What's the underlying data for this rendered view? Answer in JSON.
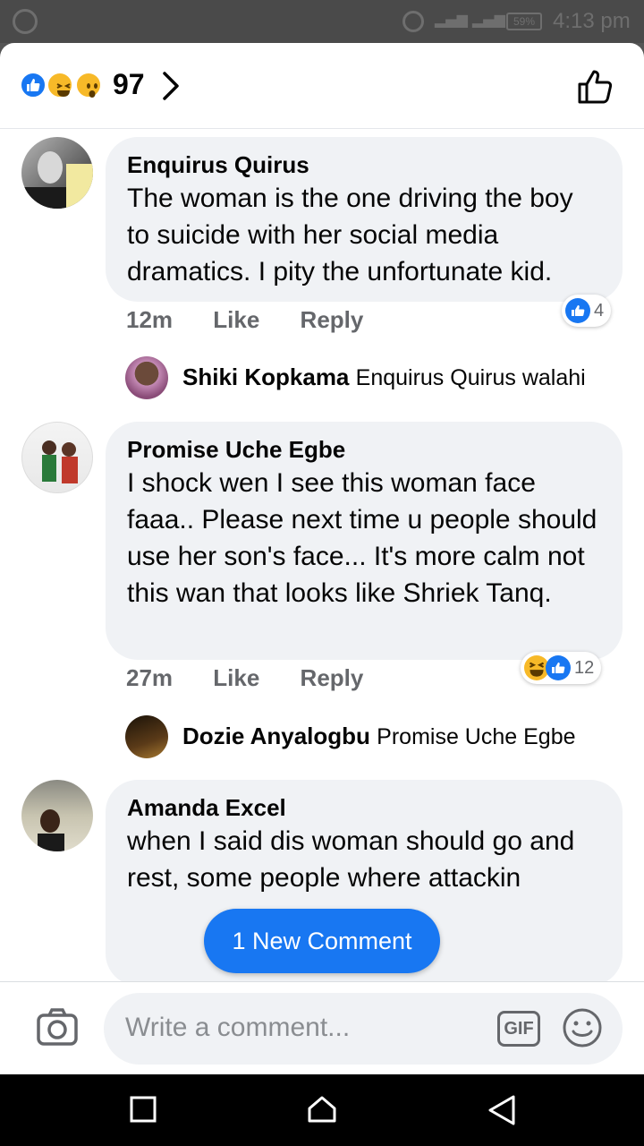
{
  "status_bar": {
    "time": "4:13 pm",
    "battery": "59%"
  },
  "reactions": {
    "count": "97",
    "types": [
      "like",
      "haha",
      "wow"
    ]
  },
  "comments": [
    {
      "author": "Enquirus Quirus",
      "text": "The woman is the one driving the boy to suicide with her social media dramatics. I pity the unfortunate kid.",
      "time": "12m",
      "like_label": "Like",
      "reply_label": "Reply",
      "reaction_count": "4",
      "reply_preview": {
        "author": "Shiki Kopkama",
        "text": "Enquirus Quirus walahi"
      }
    },
    {
      "author": "Promise Uche Egbe",
      "text": "I shock wen I see this woman face faaa.. Please next time u people should use her son's face... It's more calm not this wan that looks like Shriek Tanq.",
      "time": "27m",
      "like_label": "Like",
      "reply_label": "Reply",
      "reaction_count": "12",
      "reply_preview": {
        "author": "Dozie Anyalogbu",
        "text": "Promise Uche Egbe"
      }
    },
    {
      "author": "Amanda Excel",
      "text": "when I said dis woman should go and rest, some people where attackin"
    }
  ],
  "new_comment_label": "1 New Comment",
  "composer": {
    "placeholder": "Write a comment...",
    "gif_label": "GIF"
  },
  "colors": {
    "accent": "#1877f2",
    "bubble": "#f0f2f5",
    "meta": "#65676b"
  }
}
